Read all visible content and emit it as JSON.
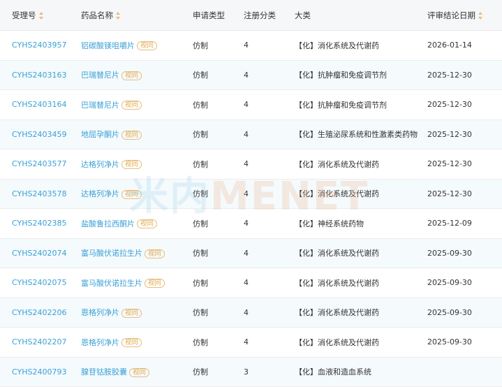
{
  "columns": [
    "受理号",
    "药品名称",
    "申请类型",
    "注册分类",
    "大类",
    "评审结论日期"
  ],
  "tag_label": "视同",
  "watermark": {
    "cn": "米内",
    "en": "MENET"
  },
  "rows": [
    {
      "code": "CYHS2403957",
      "drug": "铝碳酸镁咀嚼片",
      "type": "仿制",
      "class": "4",
      "category": "【化】消化系统及代谢药",
      "date": "2026-01-14"
    },
    {
      "code": "CYHS2403163",
      "drug": "巴瑞替尼片",
      "type": "仿制",
      "class": "4",
      "category": "【化】抗肿瘤和免疫调节剂",
      "date": "2025-12-30"
    },
    {
      "code": "CYHS2403164",
      "drug": "巴瑞替尼片",
      "type": "仿制",
      "class": "4",
      "category": "【化】抗肿瘤和免疫调节剂",
      "date": "2025-12-30"
    },
    {
      "code": "CYHS2403459",
      "drug": "地屈孕酮片",
      "type": "仿制",
      "class": "4",
      "category": "【化】生殖泌尿系统和性激素类药物",
      "date": "2025-12-30"
    },
    {
      "code": "CYHS2403577",
      "drug": "达格列净片",
      "type": "仿制",
      "class": "4",
      "category": "【化】消化系统及代谢药",
      "date": "2025-12-30"
    },
    {
      "code": "CYHS2403578",
      "drug": "达格列净片",
      "type": "仿制",
      "class": "4",
      "category": "【化】消化系统及代谢药",
      "date": "2025-12-30"
    },
    {
      "code": "CYHS2402385",
      "drug": "盐酸鲁拉西酮片",
      "type": "仿制",
      "class": "4",
      "category": "【化】神经系统药物",
      "date": "2025-12-09"
    },
    {
      "code": "CYHS2402074",
      "drug": "富马酸伏诺拉生片",
      "type": "仿制",
      "class": "4",
      "category": "【化】消化系统及代谢药",
      "date": "2025-09-30"
    },
    {
      "code": "CYHS2402075",
      "drug": "富马酸伏诺拉生片",
      "type": "仿制",
      "class": "4",
      "category": "【化】消化系统及代谢药",
      "date": "2025-09-30"
    },
    {
      "code": "CYHS2402206",
      "drug": "恩格列净片",
      "type": "仿制",
      "class": "4",
      "category": "【化】消化系统及代谢药",
      "date": "2025-09-30"
    },
    {
      "code": "CYHS2402207",
      "drug": "恩格列净片",
      "type": "仿制",
      "class": "4",
      "category": "【化】消化系统及代谢药",
      "date": "2025-09-30"
    },
    {
      "code": "CYHS2400793",
      "drug": "腺苷钴胺胶囊",
      "type": "仿制",
      "class": "3",
      "category": "【化】血液和造血系统",
      "date": ""
    }
  ]
}
